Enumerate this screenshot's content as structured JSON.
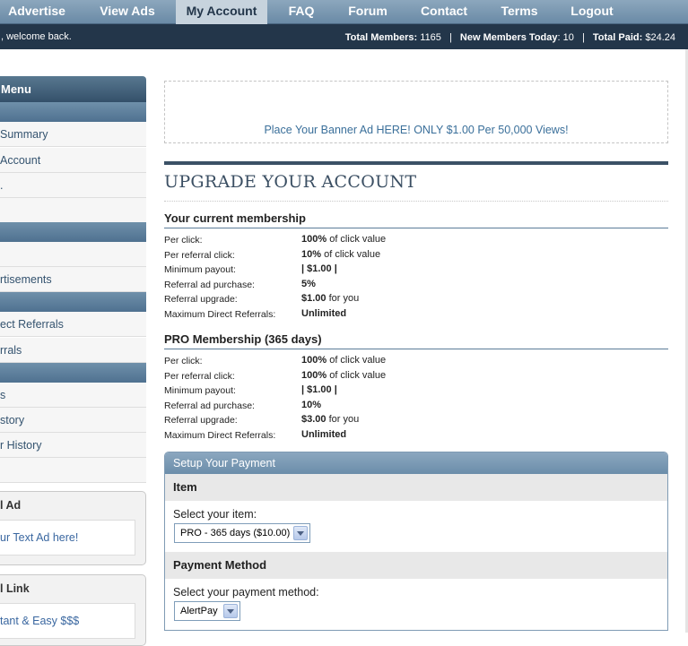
{
  "nav": {
    "items": [
      {
        "label": "Advertise"
      },
      {
        "label": "View Ads"
      },
      {
        "label": "My Account"
      },
      {
        "label": "FAQ"
      },
      {
        "label": "Forum"
      },
      {
        "label": "Contact"
      },
      {
        "label": "Terms"
      },
      {
        "label": "Logout"
      }
    ],
    "active": "My Account"
  },
  "welcome": {
    "text": ", welcome back.",
    "stats": {
      "total_members_label": "Total Members:",
      "total_members": "1165",
      "new_members_label": "New Members Today",
      "new_members": ": 10",
      "total_paid_label": "Total Paid:",
      "total_paid": "$24.24",
      "separator": "|"
    }
  },
  "sidebar": {
    "title": "Menu",
    "links": [
      "Summary",
      "Account",
      ".",
      "",
      "",
      "rtisements",
      "ect Referrals",
      "rrals",
      "s",
      "story",
      "r History",
      ""
    ],
    "text_ad_box": {
      "title": "l Ad",
      "link": "ur Text Ad here!"
    },
    "link_box": {
      "title": "l Link",
      "link": "tant & Easy $$$"
    }
  },
  "banner": {
    "text": "Place Your Banner Ad HERE! ONLY $1.00 Per 50,000 Views!"
  },
  "page": {
    "heading": "UPGRADE YOUR ACCOUNT"
  },
  "current_membership": {
    "title": "Your current membership",
    "rows": [
      {
        "label": "Per click:",
        "value": "100%",
        "suffix": " of click value"
      },
      {
        "label": "Per referral click:",
        "value": "10%",
        "suffix": " of click value"
      },
      {
        "label": "Minimum payout:",
        "value": "| $1.00 |",
        "suffix": ""
      },
      {
        "label": "Referral ad purchase:",
        "value": "5%",
        "suffix": ""
      },
      {
        "label": "Referral upgrade:",
        "value": "$1.00",
        "suffix": " for you"
      },
      {
        "label": "Maximum Direct Referrals:",
        "value": "Unlimited",
        "suffix": ""
      }
    ]
  },
  "pro_membership": {
    "title": "PRO Membership (365 days)",
    "rows": [
      {
        "label": "Per click:",
        "value": "100%",
        "suffix": " of click value"
      },
      {
        "label": "Per referral click:",
        "value": "100%",
        "suffix": " of click value"
      },
      {
        "label": "Minimum payout:",
        "value": "| $1.00 |",
        "suffix": ""
      },
      {
        "label": "Referral ad purchase:",
        "value": "10%",
        "suffix": ""
      },
      {
        "label": "Referral upgrade:",
        "value": "$3.00",
        "suffix": " for you"
      },
      {
        "label": "Maximum Direct Referrals:",
        "value": "Unlimited",
        "suffix": ""
      }
    ]
  },
  "payment": {
    "header": "Setup Your Payment",
    "item_section": "Item",
    "item_label": "Select your item:",
    "item_selected": "PRO - 365 days ($10.00)",
    "method_section": "Payment Method",
    "method_label": "Select your payment method:",
    "method_selected": "AlertPay"
  },
  "colors": {
    "nav_bg": "#7895b0",
    "welcome_bg": "#23364a",
    "accent": "#3b5166",
    "link": "#3a67a0"
  }
}
